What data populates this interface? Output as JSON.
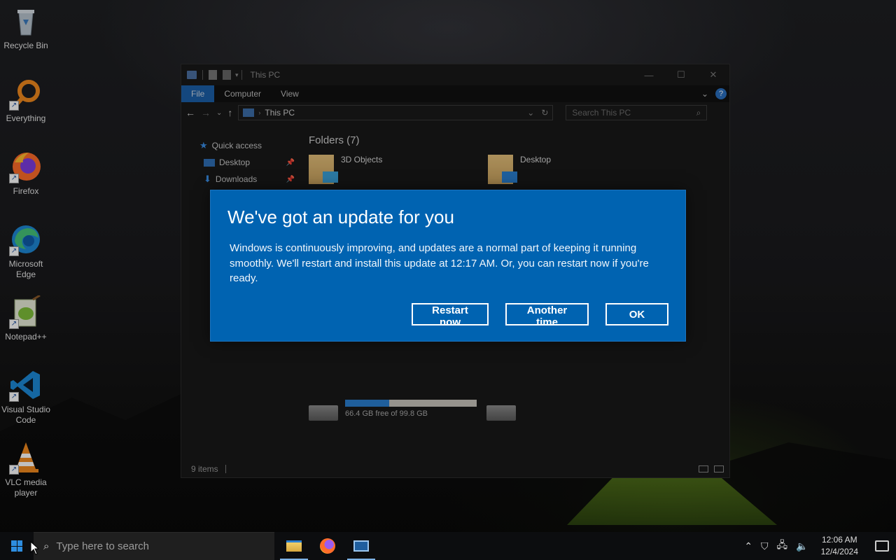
{
  "desktop": {
    "icons": [
      {
        "name": "recycle-bin",
        "label": "Recycle Bin"
      },
      {
        "name": "everything",
        "label": "Everything"
      },
      {
        "name": "firefox",
        "label": "Firefox"
      },
      {
        "name": "microsoft-edge",
        "label": "Microsoft Edge"
      },
      {
        "name": "notepad-plus-plus",
        "label": "Notepad++"
      },
      {
        "name": "visual-studio-code",
        "label": "Visual Studio Code"
      },
      {
        "name": "vlc-media-player",
        "label": "VLC media player"
      }
    ]
  },
  "explorer": {
    "title": "This PC",
    "ribbon_tabs": [
      "File",
      "Computer",
      "View"
    ],
    "address": "This PC",
    "search_placeholder": "Search This PC",
    "nav": {
      "quick_access": "Quick access",
      "desktop": "Desktop",
      "downloads": "Downloads"
    },
    "folders_header": "Folders (7)",
    "folders": [
      "3D Objects",
      "Desktop"
    ],
    "drive": {
      "free_text": "66.4 GB free of 99.8 GB",
      "used_fraction": 0.335
    },
    "status": "9 items"
  },
  "dialog": {
    "title": "We've got an update for you",
    "body": "Windows is continuously improving, and updates are a normal part of keeping it running smoothly. We'll restart and install this update at 12:17 AM. Or, you can restart now if you're ready.",
    "buttons": {
      "restart": "Restart now",
      "later": "Another time",
      "ok": "OK"
    },
    "background": "#0063b1"
  },
  "taskbar": {
    "search_placeholder": "Type here to search",
    "apps": [
      "file-explorer",
      "firefox",
      "window"
    ],
    "time": "12:06 AM",
    "date": "12/4/2024"
  }
}
